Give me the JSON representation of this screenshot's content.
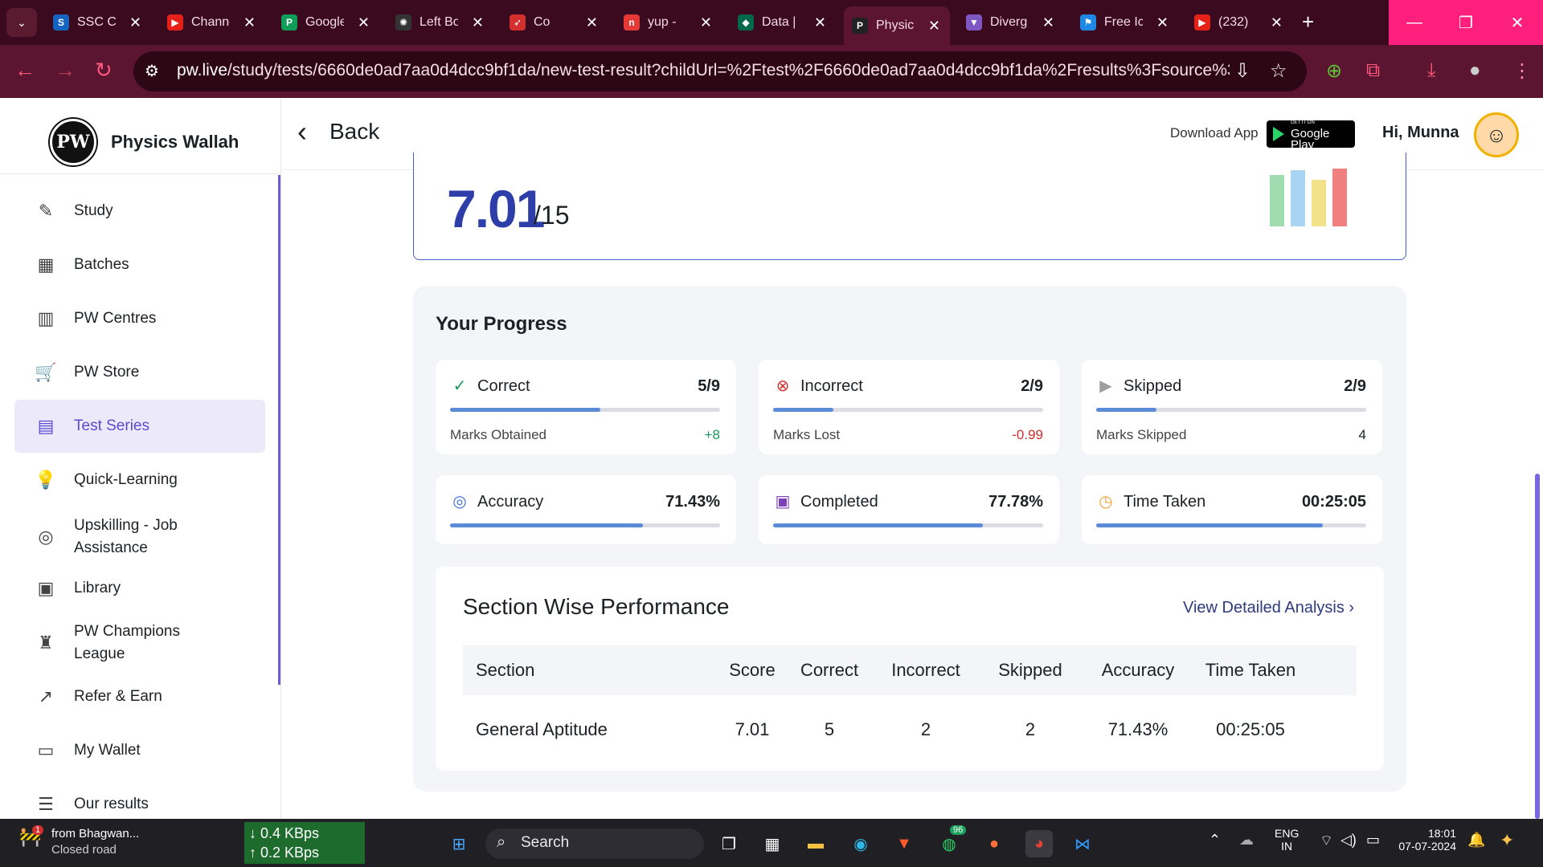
{
  "browser": {
    "tabs": [
      {
        "label": "SSC CGL",
        "fav_color": "#1565c0",
        "fav_char": "S"
      },
      {
        "label": "Channel",
        "fav_color": "#e62117",
        "fav_char": "▶"
      },
      {
        "label": "Google",
        "fav_color": "#0f9d58",
        "fav_char": "P"
      },
      {
        "label": "Left Bo",
        "fav_color": "#333333",
        "fav_char": "✺"
      },
      {
        "label": "Co",
        "fav_color": "#d32f2f",
        "fav_char": "➶"
      },
      {
        "label": "yup -",
        "fav_color": "#e53935",
        "fav_char": "n"
      },
      {
        "label": "Data |",
        "fav_color": "#00684a",
        "fav_char": "◆"
      },
      {
        "label": "Physic",
        "fav_color": "#222222",
        "fav_char": "P"
      },
      {
        "label": "Diverg",
        "fav_color": "#7e57c2",
        "fav_char": "▼"
      },
      {
        "label": "Free Ic",
        "fav_color": "#1e88e5",
        "fav_char": "⚑"
      },
      {
        "label": "(232)",
        "fav_color": "#e62117",
        "fav_char": "▶"
      }
    ],
    "url_domain": "pw.live",
    "url_path": "/study/tests/6660de0ad7aa0d4dcc9bf1da/new-test-result?childUrl=%2Ftest%2F6660de0ad7aa0d4dcc9bf1da%2Fresults%3Fsource%3DTEST_SE..."
  },
  "sidebar": {
    "brand": "Physics Wallah",
    "logo_text": "PW",
    "items": [
      {
        "label": "Study",
        "icon": "✎"
      },
      {
        "label": "Batches",
        "icon": "▦"
      },
      {
        "label": "PW Centres",
        "icon": "▥"
      },
      {
        "label": "PW Store",
        "icon": "🛒"
      },
      {
        "label": "Test Series",
        "icon": "▤"
      },
      {
        "label": "Quick-Learning",
        "icon": "💡"
      },
      {
        "label": "Upskilling - Job Assistance",
        "icon": "◎"
      },
      {
        "label": "Library",
        "icon": "▣"
      },
      {
        "label": "PW Champions League",
        "icon": "♜"
      },
      {
        "label": "Refer & Earn",
        "icon": "↗"
      },
      {
        "label": "My Wallet",
        "icon": "▭"
      },
      {
        "label": "Our results",
        "icon": "☰"
      }
    ]
  },
  "header": {
    "back_label": "Back",
    "download_label": "Download App",
    "gplay_small": "GET IT ON",
    "gplay_big": "Google Play",
    "greeting": "Hi, Munna"
  },
  "score": {
    "value": "7.01",
    "total": "/15",
    "bar_colors": [
      "#9fdcb0",
      "#a9d4f2",
      "#f2e28a",
      "#f08080"
    ]
  },
  "progress": {
    "title": "Your Progress",
    "cards": [
      {
        "title": "Correct",
        "value": "5/9",
        "fill": 0.556,
        "sub": "Marks Obtained",
        "subval": "+8",
        "subval_color": "#1a9a5a",
        "icon": "✓",
        "icon_color": "#1a9a5a"
      },
      {
        "title": "Incorrect",
        "value": "2/9",
        "fill": 0.222,
        "sub": "Marks Lost",
        "subval": "-0.99",
        "subval_color": "#d32f2f",
        "icon": "⊗",
        "icon_color": "#d32f2f"
      },
      {
        "title": "Skipped",
        "value": "2/9",
        "fill": 0.222,
        "sub": "Marks Skipped",
        "subval": "4",
        "subval_color": "#1b2124",
        "icon": "▶",
        "icon_color": "#9e9e9e"
      },
      {
        "title": "Accuracy",
        "value": "71.43%",
        "fill": 0.7143,
        "icon": "◎",
        "icon_color": "#3f6fd6"
      },
      {
        "title": "Completed",
        "value": "77.78%",
        "fill": 0.7778,
        "icon": "▣",
        "icon_color": "#7b3fb8"
      },
      {
        "title": "Time Taken",
        "value": "00:25:05",
        "fill": 0.84,
        "icon": "◷",
        "icon_color": "#f0a030"
      }
    ]
  },
  "section_perf": {
    "title": "Section Wise Performance",
    "link": "View Detailed Analysis",
    "columns": [
      "Section",
      "Score",
      "Correct",
      "Incorrect",
      "Skipped",
      "Accuracy",
      "Time Taken"
    ],
    "rows": [
      [
        "General Aptitude",
        "7.01",
        "5",
        "2",
        "2",
        "71.43%",
        "00:25:05"
      ]
    ]
  },
  "taskbar": {
    "notif_title": "from Bhagwan...",
    "notif_sub": "Closed road",
    "net_down": "↓ 0.4 KBps",
    "net_up": "↑ 0.2 KBps",
    "search_label": "Search",
    "lang_top": "ENG",
    "lang_bottom": "IN",
    "time": "18:01",
    "date": "07-07-2024",
    "whatsapp_badge": "96",
    "notif_badge": "1"
  }
}
